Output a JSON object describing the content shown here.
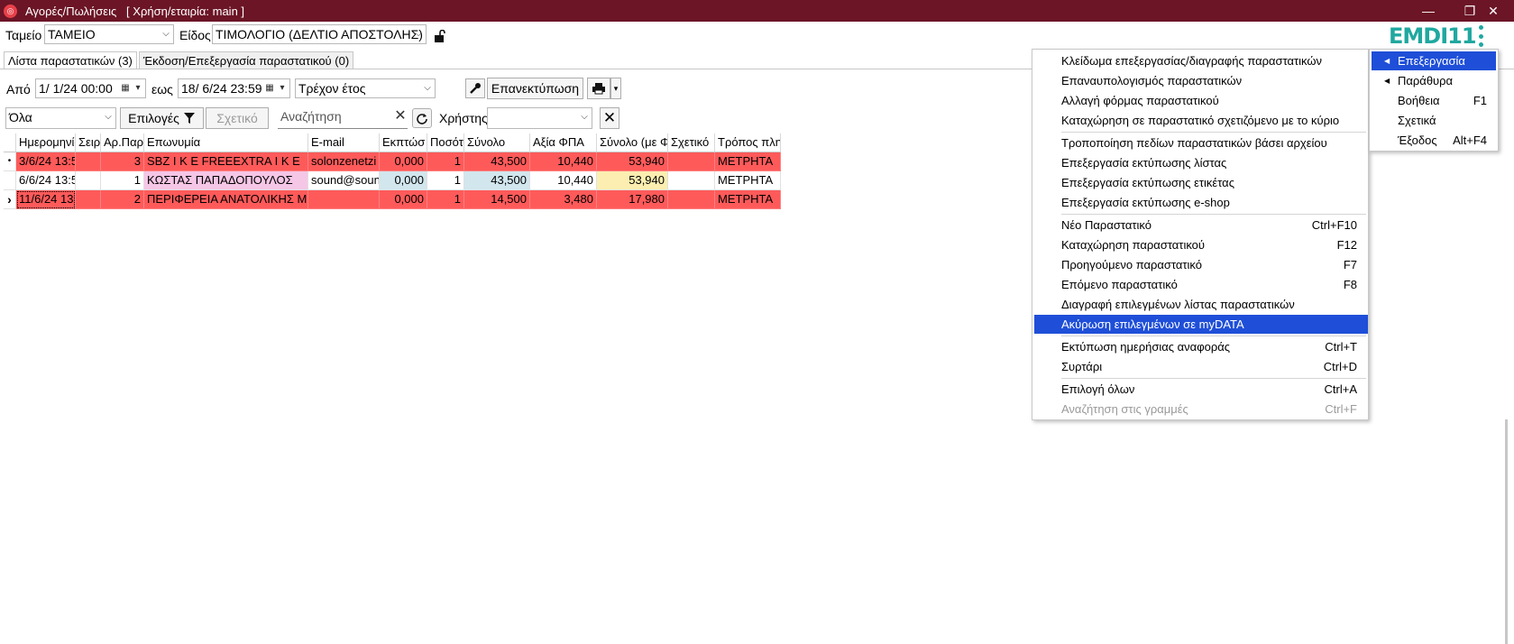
{
  "window": {
    "title": "Αγορές/Πωλήσεις   [ Χρήση/εταιρία: main ]",
    "minimize": "—",
    "maximize": "❐",
    "close": "✕"
  },
  "filters": {
    "tameio_label": "Ταμείο",
    "tameio_value": "ΤΑΜΕΙΟ",
    "eidos_label": "Είδος",
    "eidos_value": "ΤΙΜΟΛΟΓΙΟ (ΔΕΛΤΙΟ ΑΠΟΣΤΟΛΗΣ)",
    "apo_label": "Από",
    "apo_value": "1/  1/24 00:00",
    "eos_label": "εως",
    "eos_value": "18/  6/24 23:59",
    "period_value": "Τρέχον έτος",
    "reprint_label": "Επανεκτύπωση",
    "ola_value": "Όλα",
    "epiloges_label": "Επιλογές",
    "sxetiko_label": "Σχετικό",
    "search_placeholder": "Αναζήτηση",
    "user_label": "Χρήστης",
    "user_value": ""
  },
  "logo": {
    "text": "EMDI11"
  },
  "tabs": [
    {
      "label": "Λίστα παραστατικών (3)"
    },
    {
      "label": "Έκδοση/Επεξεργασία παραστατικού (0)"
    }
  ],
  "table": {
    "headers": [
      "Ημερομηνία",
      "Σειρ",
      "Αρ.Παρ",
      "Επωνυμία",
      "E-mail",
      "Εκπτώσ",
      "Ποσότ",
      "Σύνολο",
      "Αξία ΦΠΑ",
      "Σύνολο (με Φ",
      "Σχετικό",
      "Τρόπος πλη"
    ],
    "rows": [
      [
        "3/6/24 13:5",
        "",
        "3",
        "SBZ I K E  FREEEXTRA I K E",
        "solonzenetzi",
        "0,000",
        "1",
        "43,500",
        "10,440",
        "53,940",
        "",
        "ΜΕΤΡΗΤΑ"
      ],
      [
        "6/6/24 13:5",
        "",
        "1",
        "ΚΩΣΤΑΣ ΠΑΠΑΔΟΠΟΥΛΟΣ",
        "sound@soun",
        "0,000",
        "1",
        "43,500",
        "10,440",
        "53,940",
        "",
        "ΜΕΤΡΗΤΑ"
      ],
      [
        "11/6/24 13",
        "",
        "2",
        "ΠΕΡΙΦΕΡΕΙΑ ΑΝΑΤΟΛΙΚΗΣ Μ",
        "",
        "0,000",
        "1",
        "14,500",
        "3,480",
        "17,980",
        "",
        "ΜΕΤΡΗΤΑ"
      ]
    ],
    "row_indicators": [
      "•",
      "",
      "›"
    ]
  },
  "context_menu": {
    "items": [
      {
        "label": "Κλείδωμα επεξεργασίας/διαγραφής παραστατικών",
        "shortcut": ""
      },
      {
        "label": "Επαναυπολογισμός παραστατικών",
        "shortcut": ""
      },
      {
        "label": "Αλλαγή φόρμας παραστατικού",
        "shortcut": ""
      },
      {
        "label": "Καταχώρηση σε παραστατικό σχετιζόμενο με το κύριο",
        "shortcut": ""
      },
      {
        "label": "Τροποποίηση πεδίων παραστατικών βάσει αρχείου",
        "shortcut": ""
      },
      {
        "label": "Επεξεργασία εκτύπωσης λίστας",
        "shortcut": ""
      },
      {
        "label": "Επεξεργασία εκτύπωσης ετικέτας",
        "shortcut": ""
      },
      {
        "label": "Επεξεργασία εκτύπωσης e-shop",
        "shortcut": ""
      },
      {
        "label": "Νέο Παραστατικό",
        "shortcut": "Ctrl+F10"
      },
      {
        "label": "Καταχώρηση παραστατικού",
        "shortcut": "F12"
      },
      {
        "label": "Προηγούμενο παραστατικό",
        "shortcut": "F7"
      },
      {
        "label": "Επόμενο παραστατικό",
        "shortcut": "F8"
      },
      {
        "label": "Διαγραφή επιλεγμένων λίστας παραστατικών",
        "shortcut": ""
      },
      {
        "label": "Ακύρωση επιλεγμένων σε myDATA",
        "shortcut": ""
      },
      {
        "label": "Εκτύπωση ημερήσιας αναφοράς",
        "shortcut": "Ctrl+T"
      },
      {
        "label": "Συρτάρι",
        "shortcut": "Ctrl+D"
      },
      {
        "label": "Επιλογή όλων",
        "shortcut": "Ctrl+A"
      },
      {
        "label": "Αναζήτηση στις γραμμές",
        "shortcut": "Ctrl+F"
      }
    ]
  },
  "main_menu": {
    "items": [
      {
        "label": "Επεξεργασία",
        "shortcut": ""
      },
      {
        "label": "Παράθυρα",
        "shortcut": ""
      },
      {
        "label": "Βοήθεια",
        "shortcut": "F1"
      },
      {
        "label": "Σχετικά",
        "shortcut": ""
      },
      {
        "label": "Έξοδος",
        "shortcut": "Alt+F4"
      }
    ]
  },
  "colors": {
    "titlebar": "#6b1526",
    "row_red": "#ff5a5a",
    "highlight_blue": "#1f4fd8",
    "logo_teal": "#1fa8a0",
    "cell_pink": "#f5c6e6",
    "cell_lightblue": "#d2e6ee",
    "cell_yellow": "#fbeeb0"
  }
}
